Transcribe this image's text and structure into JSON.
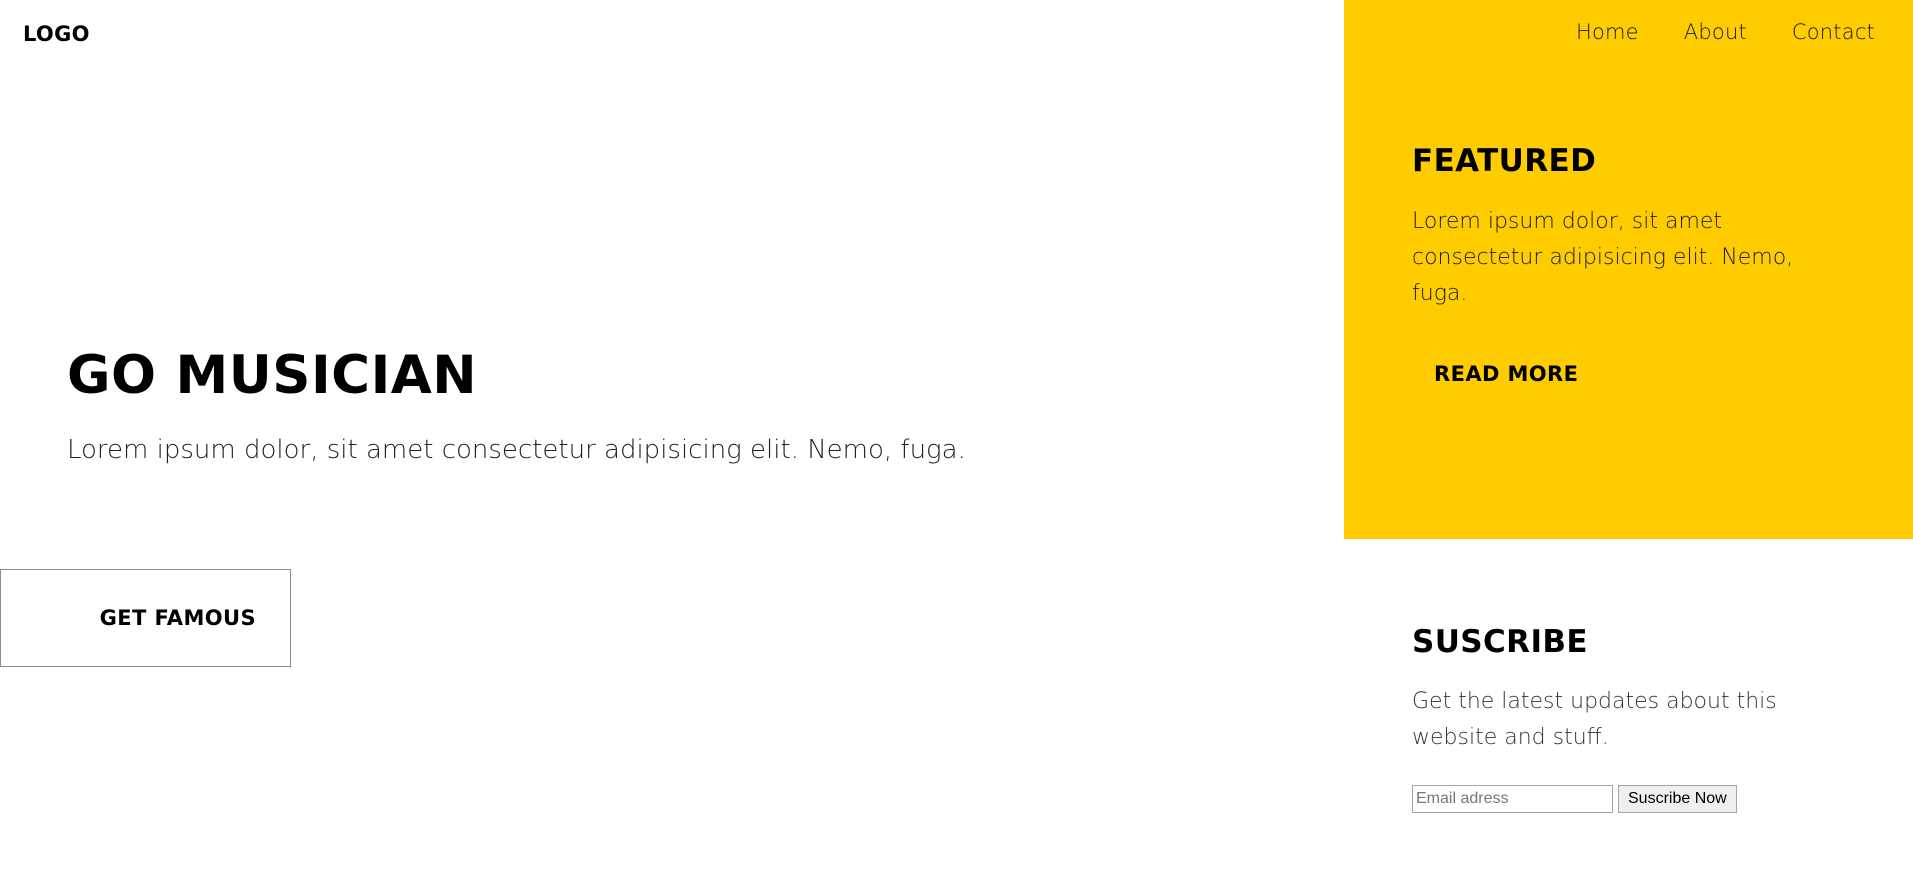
{
  "header": {
    "logo": "LOGO",
    "nav": [
      "Home",
      "About",
      "Contact"
    ]
  },
  "hero": {
    "title": "GO MUSICIAN",
    "text": "Lorem ipsum dolor, sit amet consectetur adipisicing elit. Nemo, fuga.",
    "cta_label": "GET FAMOUS"
  },
  "featured": {
    "title": "FEATURED",
    "text": "Lorem ipsum dolor, sit amet consectetur adipisicing elit. Nemo, fuga.",
    "link_label": "READ MORE",
    "background_color": "#ffcc00"
  },
  "subscribe": {
    "title": "SUSCRIBE",
    "text": "Get the latest updates about this website and stuff.",
    "email_placeholder": "Email adress",
    "button_label": "Suscribe Now"
  }
}
